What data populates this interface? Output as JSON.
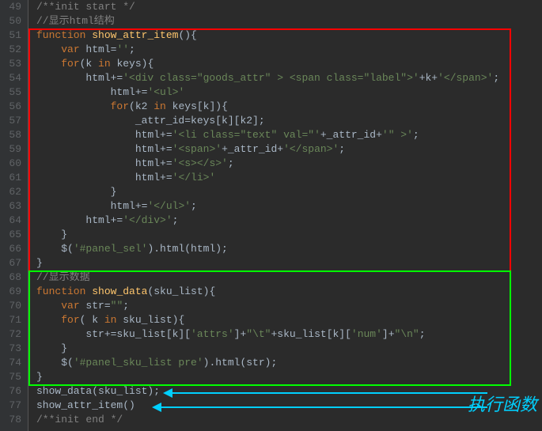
{
  "lines": [
    {
      "n": 49,
      "tokens": [
        [
          "comment",
          "/**init start */"
        ]
      ]
    },
    {
      "n": 50,
      "tokens": [
        [
          "comment",
          "//显示html结构"
        ]
      ]
    },
    {
      "n": 51,
      "tokens": [
        [
          "keyword",
          "function"
        ],
        [
          "ident",
          " "
        ],
        [
          "func",
          "show_attr_item"
        ],
        [
          "punct",
          "(){"
        ]
      ]
    },
    {
      "n": 52,
      "tokens": [
        [
          "ident",
          "    "
        ],
        [
          "keyword",
          "var"
        ],
        [
          "ident",
          " html="
        ],
        [
          "string",
          "''"
        ],
        [
          "punct",
          ";"
        ]
      ]
    },
    {
      "n": 53,
      "tokens": [
        [
          "ident",
          "    "
        ],
        [
          "keyword",
          "for"
        ],
        [
          "punct",
          "(k "
        ],
        [
          "keyword",
          "in"
        ],
        [
          "ident",
          " keys){"
        ]
      ]
    },
    {
      "n": 54,
      "tokens": [
        [
          "ident",
          "        html+="
        ],
        [
          "string",
          "'<div class=\"goods_attr\" > <span class=\"label\">'"
        ],
        [
          "ident",
          "+k+"
        ],
        [
          "string",
          "'</span>'"
        ],
        [
          "punct",
          ";"
        ]
      ]
    },
    {
      "n": 55,
      "tokens": [
        [
          "ident",
          "            html+="
        ],
        [
          "string",
          "'<ul>'"
        ]
      ]
    },
    {
      "n": 56,
      "tokens": [
        [
          "ident",
          "            "
        ],
        [
          "keyword",
          "for"
        ],
        [
          "punct",
          "(k2 "
        ],
        [
          "keyword",
          "in"
        ],
        [
          "ident",
          " keys[k]){"
        ]
      ]
    },
    {
      "n": 57,
      "tokens": [
        [
          "ident",
          "                _attr_id=keys[k][k2];"
        ]
      ]
    },
    {
      "n": 58,
      "tokens": [
        [
          "ident",
          "                html+="
        ],
        [
          "string",
          "'<li class=\"text\" val=\"'"
        ],
        [
          "ident",
          "+_attr_id+"
        ],
        [
          "string",
          "'\" >'"
        ],
        [
          "punct",
          ";"
        ]
      ]
    },
    {
      "n": 59,
      "tokens": [
        [
          "ident",
          "                html+="
        ],
        [
          "string",
          "'<span>'"
        ],
        [
          "ident",
          "+_attr_id+"
        ],
        [
          "string",
          "'</span>'"
        ],
        [
          "punct",
          ";"
        ]
      ]
    },
    {
      "n": 60,
      "tokens": [
        [
          "ident",
          "                html+="
        ],
        [
          "string",
          "'<s></s>'"
        ],
        [
          "punct",
          ";"
        ]
      ]
    },
    {
      "n": 61,
      "tokens": [
        [
          "ident",
          "                html+="
        ],
        [
          "string",
          "'</li>'"
        ]
      ]
    },
    {
      "n": 62,
      "tokens": [
        [
          "ident",
          "            }"
        ]
      ]
    },
    {
      "n": 63,
      "tokens": [
        [
          "ident",
          "            html+="
        ],
        [
          "string",
          "'</ul>'"
        ],
        [
          "punct",
          ";"
        ]
      ]
    },
    {
      "n": 64,
      "tokens": [
        [
          "ident",
          "        html+="
        ],
        [
          "string",
          "'</div>'"
        ],
        [
          "punct",
          ";"
        ]
      ]
    },
    {
      "n": 65,
      "tokens": [
        [
          "ident",
          "    }"
        ]
      ]
    },
    {
      "n": 66,
      "tokens": [
        [
          "ident",
          "    $("
        ],
        [
          "string",
          "'#panel_sel'"
        ],
        [
          "ident",
          ").html(html);"
        ]
      ]
    },
    {
      "n": 67,
      "tokens": [
        [
          "ident",
          "}"
        ]
      ]
    },
    {
      "n": 68,
      "tokens": [
        [
          "comment",
          "//显示数据"
        ]
      ]
    },
    {
      "n": 69,
      "tokens": [
        [
          "keyword",
          "function"
        ],
        [
          "ident",
          " "
        ],
        [
          "func",
          "show_data"
        ],
        [
          "punct",
          "(sku_list){"
        ]
      ]
    },
    {
      "n": 70,
      "tokens": [
        [
          "ident",
          "    "
        ],
        [
          "keyword",
          "var"
        ],
        [
          "ident",
          " str="
        ],
        [
          "string",
          "\"\""
        ],
        [
          "punct",
          ";"
        ]
      ]
    },
    {
      "n": 71,
      "tokens": [
        [
          "ident",
          "    "
        ],
        [
          "keyword",
          "for"
        ],
        [
          "punct",
          "( k "
        ],
        [
          "keyword",
          "in"
        ],
        [
          "ident",
          " sku_list){"
        ]
      ]
    },
    {
      "n": 72,
      "tokens": [
        [
          "ident",
          "        str+=sku_list[k]["
        ],
        [
          "string",
          "'attrs'"
        ],
        [
          "ident",
          "]+"
        ],
        [
          "string",
          "\"\\t\""
        ],
        [
          "ident",
          "+sku_list[k]["
        ],
        [
          "string",
          "'num'"
        ],
        [
          "ident",
          "]+"
        ],
        [
          "string",
          "\"\\n\""
        ],
        [
          "punct",
          ";"
        ]
      ]
    },
    {
      "n": 73,
      "tokens": [
        [
          "ident",
          "    }"
        ]
      ]
    },
    {
      "n": 74,
      "tokens": [
        [
          "ident",
          "    $("
        ],
        [
          "string",
          "'#panel_sku_list pre'"
        ],
        [
          "ident",
          ").html(str);"
        ]
      ]
    },
    {
      "n": 75,
      "tokens": [
        [
          "ident",
          "}"
        ]
      ]
    },
    {
      "n": 76,
      "tokens": [
        [
          "ident",
          "show_data(sku_list);"
        ]
      ]
    },
    {
      "n": 77,
      "tokens": [
        [
          "ident",
          "show_attr_item()"
        ]
      ]
    },
    {
      "n": 78,
      "tokens": [
        [
          "comment",
          "/**init end */"
        ]
      ]
    }
  ],
  "annotation": "执行函数"
}
